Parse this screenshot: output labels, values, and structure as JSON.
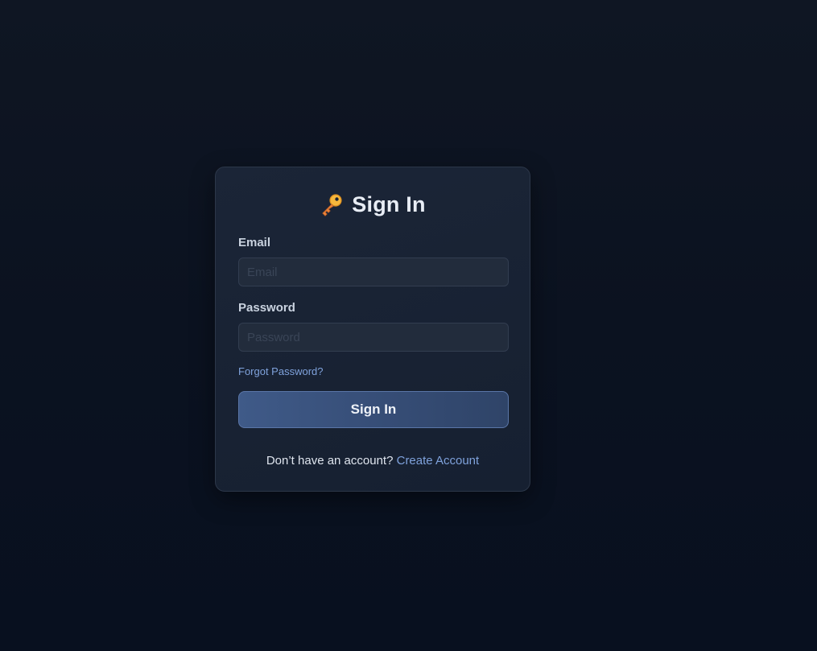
{
  "login": {
    "title": "Sign In",
    "title_icon": "key-icon",
    "email_label": "Email",
    "email_placeholder": "Email",
    "email_value": "",
    "password_label": "Password",
    "password_placeholder": "Password",
    "password_value": "",
    "forgot_link": "Forgot Password?",
    "submit_label": "Sign In",
    "footer_text": "Don’t have an account?",
    "create_account_link": "Create Account"
  },
  "colors": {
    "background": "#0b1220",
    "card": "#1a2435",
    "accent_link": "#7fa2dc",
    "button": "#3f5a88"
  }
}
